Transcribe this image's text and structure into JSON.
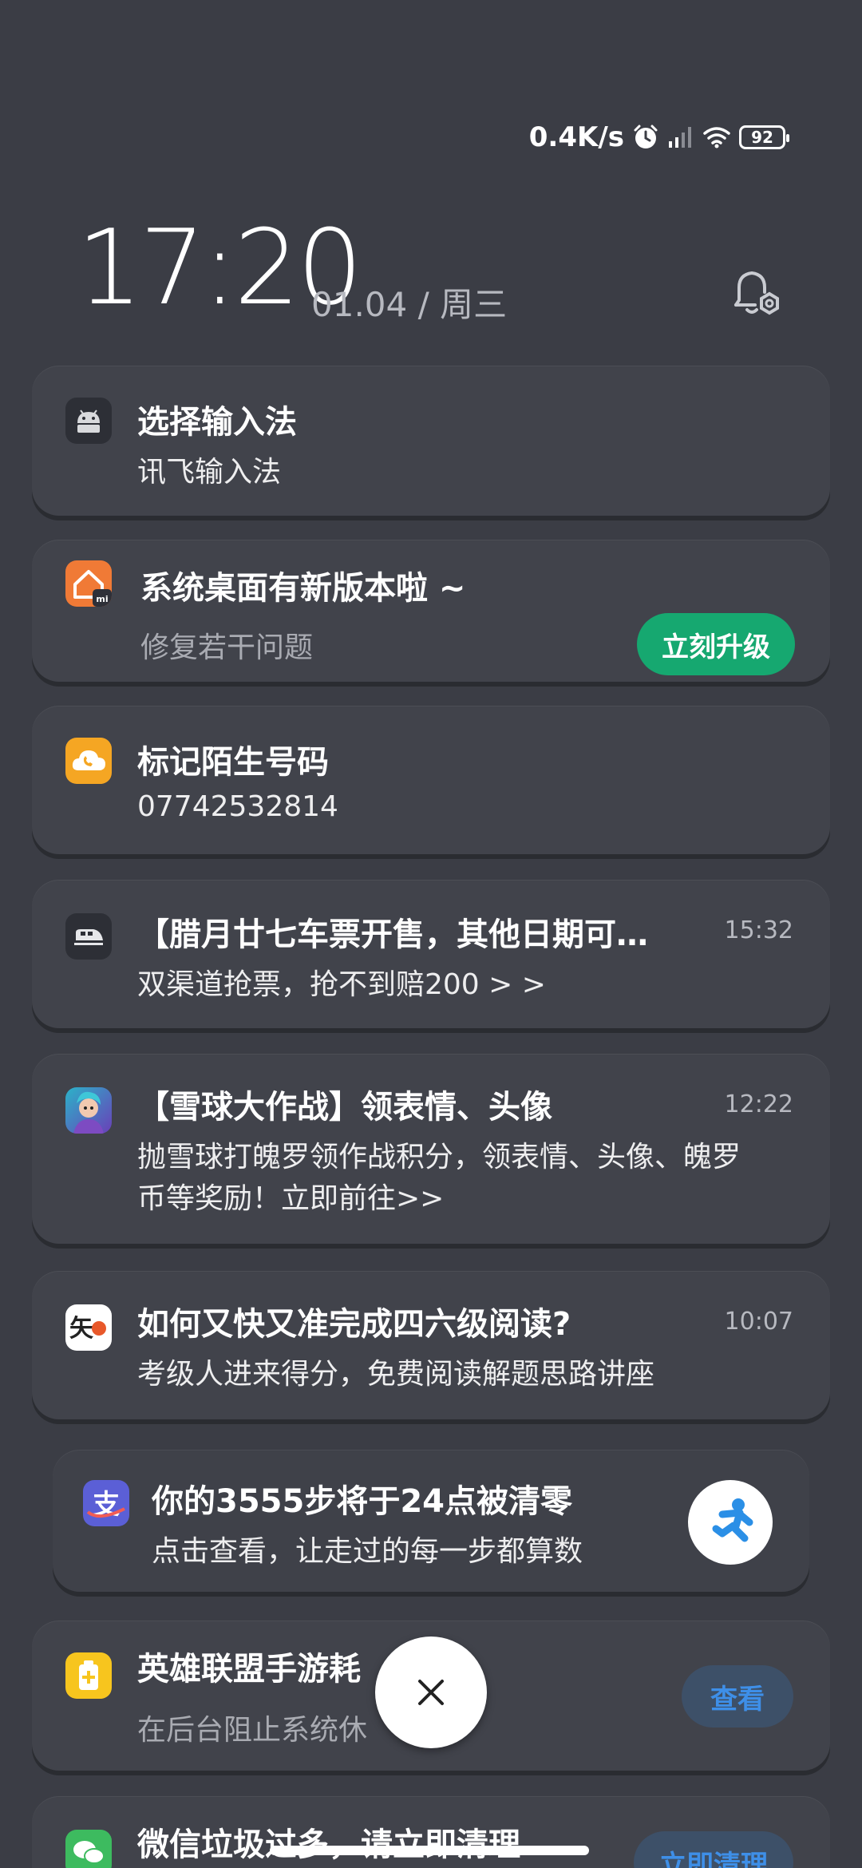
{
  "status_bar": {
    "network_speed": "0.4K/s",
    "battery": "92",
    "icons": [
      "alarm-icon",
      "signal-icon",
      "wifi-icon",
      "battery-icon"
    ]
  },
  "header": {
    "time": "17:20",
    "date": "01.04 / 周三",
    "settings_icon": "notification-settings-icon"
  },
  "notifications": [
    {
      "title": "选择输入法",
      "text": "讯飞输入法",
      "icon": "android-icon"
    },
    {
      "title": "系统桌面有新版本啦 ~",
      "text": "修复若干问题",
      "action": "立刻升级",
      "icon": "home-launcher-icon"
    },
    {
      "title": "标记陌生号码",
      "text": "07742532814",
      "icon": "phone-cloud-icon"
    },
    {
      "title": "【腊月廿七车票开售，其他日期可…",
      "text": "双渠道抢票，抢不到赔200 > >",
      "time": "15:32",
      "icon": "train-icon"
    },
    {
      "title": "【雪球大作战】领表情、头像",
      "text_line1": "抛雪球打魄罗领作战积分，领表情、头像、魄罗",
      "text_line2": "币等奖励！立即前往>>",
      "time": "12:22",
      "icon": "game-character-icon"
    },
    {
      "title": "如何又快又准完成四六级阅读?",
      "text": "考级人进来得分，免费阅读解题思路讲座",
      "time": "10:07",
      "icon": "zhihu-reading-icon"
    },
    {
      "title": "你的3555步将于24点被清零",
      "text": "点击查看，让走过的每一步都算数",
      "icon": "alipay-icon",
      "thumb": "running-man-icon"
    },
    {
      "title": "英雄联盟手游耗",
      "text": "在后台阻止系统休",
      "action": "查看",
      "icon": "battery-saver-icon"
    },
    {
      "title": "微信垃圾过多，请立即清理",
      "action": "立即清理",
      "icon": "wechat-icon"
    }
  ],
  "colors": {
    "background": "#3b3d45",
    "card": "#41434b",
    "green_button": "#16a870",
    "blue_text": "#3e8fe8"
  }
}
